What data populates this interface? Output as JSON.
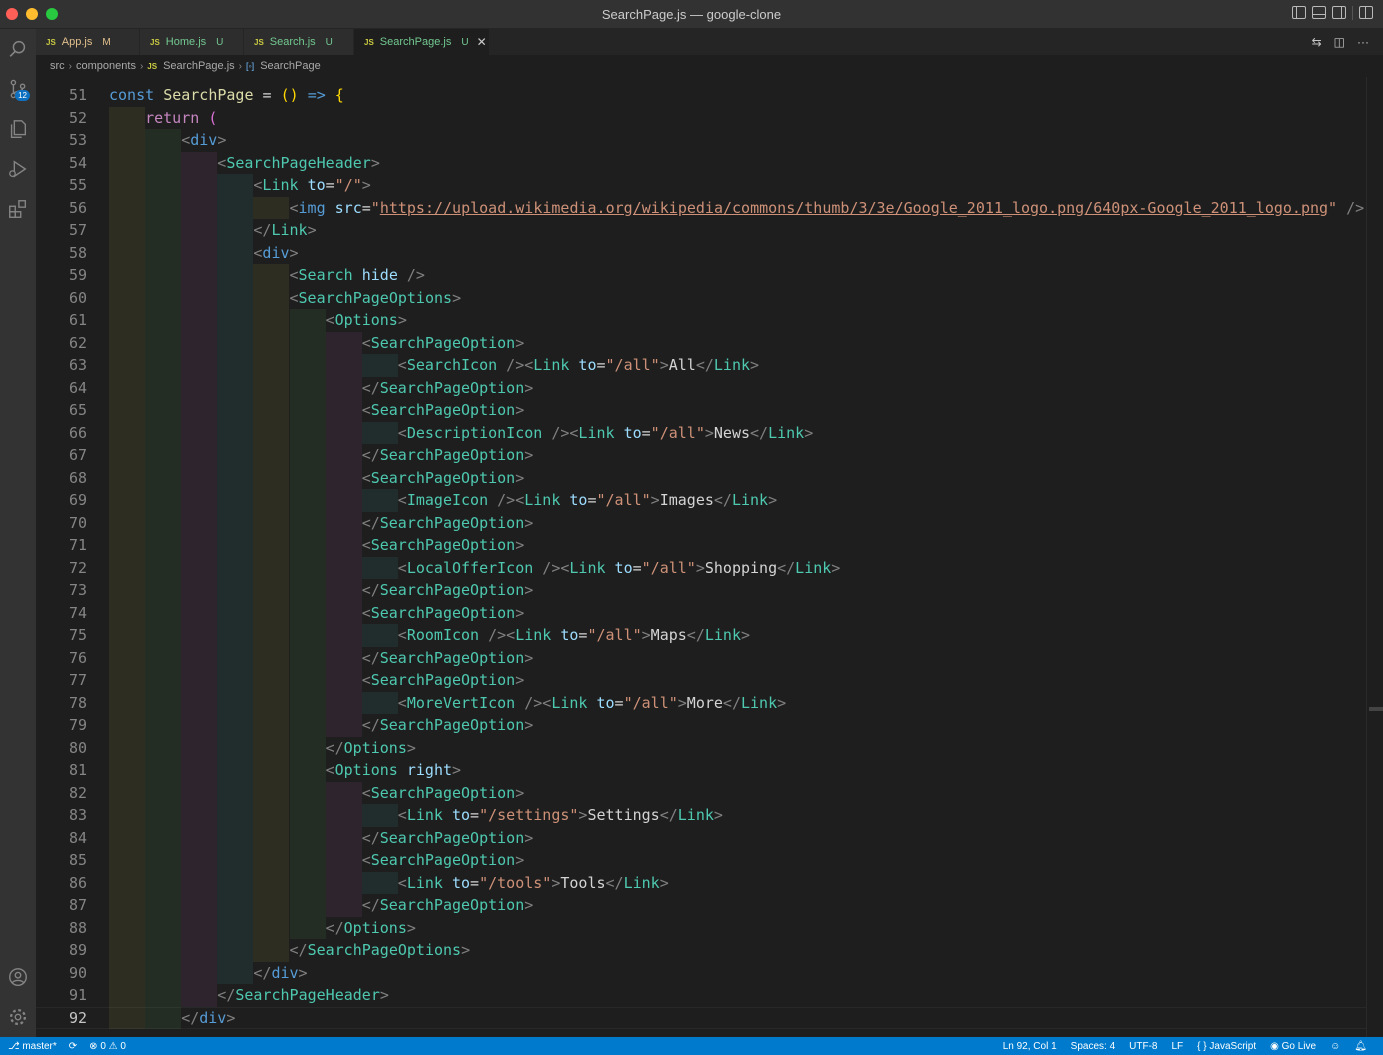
{
  "window": {
    "title": "SearchPage.js — google-clone"
  },
  "activity_bar": {
    "source_control_badge": "12"
  },
  "tabs": [
    {
      "label": "App.js",
      "status": "M",
      "active": false
    },
    {
      "label": "Home.js",
      "status": "U",
      "active": false
    },
    {
      "label": "Search.js",
      "status": "U",
      "active": false
    },
    {
      "label": "SearchPage.js",
      "status": "U",
      "active": true
    }
  ],
  "tab_file_icon": "JS",
  "tab_close_glyph": "✕",
  "breadcrumb": {
    "items": [
      "src",
      "components",
      "SearchPage.js",
      "SearchPage"
    ]
  },
  "editor": {
    "current_line": "92",
    "lines": [
      {
        "n": "51",
        "tokens": [
          [
            "kw",
            "const "
          ],
          [
            "fn",
            "SearchPage"
          ],
          [
            "op",
            " = "
          ],
          [
            "br",
            "()"
          ],
          [
            "op",
            " "
          ],
          [
            "kw",
            "=>"
          ],
          [
            "op",
            " "
          ],
          [
            "br",
            "{"
          ]
        ]
      },
      {
        "n": "52",
        "tokens": [
          [
            "kw2",
            "return "
          ],
          [
            "br2",
            "("
          ]
        ]
      },
      {
        "n": "53",
        "tokens": [
          [
            "pn",
            "<"
          ],
          [
            "tgh",
            "div"
          ],
          [
            "pn",
            ">"
          ]
        ]
      },
      {
        "n": "54",
        "tokens": [
          [
            "pn",
            "<"
          ],
          [
            "tg",
            "SearchPageHeader"
          ],
          [
            "pn",
            ">"
          ]
        ]
      },
      {
        "n": "55",
        "tokens": [
          [
            "pn",
            "<"
          ],
          [
            "tg",
            "Link"
          ],
          [
            "op",
            " "
          ],
          [
            "at",
            "to"
          ],
          [
            "op",
            "="
          ],
          [
            "st",
            "\"/\""
          ],
          [
            "pn",
            ">"
          ]
        ]
      },
      {
        "n": "56",
        "tokens": [
          [
            "pn",
            "<"
          ],
          [
            "tgh",
            "img"
          ],
          [
            "op",
            " "
          ],
          [
            "at",
            "src"
          ],
          [
            "op",
            "="
          ],
          [
            "st",
            "\""
          ],
          [
            "ln",
            "https://upload.wikimedia.org/wikipedia/commons/thumb/3/3e/Google_2011_logo.png/640px-Google_2011_logo.png"
          ],
          [
            "st",
            "\""
          ],
          [
            "op",
            " "
          ],
          [
            "pn",
            "/>"
          ]
        ]
      },
      {
        "n": "57",
        "tokens": [
          [
            "pn",
            "</"
          ],
          [
            "tg",
            "Link"
          ],
          [
            "pn",
            ">"
          ]
        ]
      },
      {
        "n": "58",
        "tokens": [
          [
            "pn",
            "<"
          ],
          [
            "tgh",
            "div"
          ],
          [
            "pn",
            ">"
          ]
        ]
      },
      {
        "n": "59",
        "tokens": [
          [
            "pn",
            "<"
          ],
          [
            "tg",
            "Search"
          ],
          [
            "op",
            " "
          ],
          [
            "at",
            "hide"
          ],
          [
            "op",
            " "
          ],
          [
            "pn",
            "/>"
          ]
        ]
      },
      {
        "n": "60",
        "tokens": [
          [
            "pn",
            "<"
          ],
          [
            "tg",
            "SearchPageOptions"
          ],
          [
            "pn",
            ">"
          ]
        ]
      },
      {
        "n": "61",
        "tokens": [
          [
            "pn",
            "<"
          ],
          [
            "tg",
            "Options"
          ],
          [
            "pn",
            ">"
          ]
        ]
      },
      {
        "n": "62",
        "tokens": [
          [
            "pn",
            "<"
          ],
          [
            "tg",
            "SearchPageOption"
          ],
          [
            "pn",
            ">"
          ]
        ]
      },
      {
        "n": "63",
        "tokens": [
          [
            "pn",
            "<"
          ],
          [
            "tg",
            "SearchIcon"
          ],
          [
            "op",
            " "
          ],
          [
            "pn",
            "/><"
          ],
          [
            "tg",
            "Link"
          ],
          [
            "op",
            " "
          ],
          [
            "at",
            "to"
          ],
          [
            "op",
            "="
          ],
          [
            "st",
            "\"/all\""
          ],
          [
            "pn",
            ">"
          ],
          [
            "tx",
            "All"
          ],
          [
            "pn",
            "</"
          ],
          [
            "tg",
            "Link"
          ],
          [
            "pn",
            ">"
          ]
        ]
      },
      {
        "n": "64",
        "tokens": [
          [
            "pn",
            "</"
          ],
          [
            "tg",
            "SearchPageOption"
          ],
          [
            "pn",
            ">"
          ]
        ]
      },
      {
        "n": "65",
        "tokens": [
          [
            "pn",
            "<"
          ],
          [
            "tg",
            "SearchPageOption"
          ],
          [
            "pn",
            ">"
          ]
        ]
      },
      {
        "n": "66",
        "tokens": [
          [
            "pn",
            "<"
          ],
          [
            "tg",
            "DescriptionIcon"
          ],
          [
            "op",
            " "
          ],
          [
            "pn",
            "/><"
          ],
          [
            "tg",
            "Link"
          ],
          [
            "op",
            " "
          ],
          [
            "at",
            "to"
          ],
          [
            "op",
            "="
          ],
          [
            "st",
            "\"/all\""
          ],
          [
            "pn",
            ">"
          ],
          [
            "tx",
            "News"
          ],
          [
            "pn",
            "</"
          ],
          [
            "tg",
            "Link"
          ],
          [
            "pn",
            ">"
          ]
        ]
      },
      {
        "n": "67",
        "tokens": [
          [
            "pn",
            "</"
          ],
          [
            "tg",
            "SearchPageOption"
          ],
          [
            "pn",
            ">"
          ]
        ]
      },
      {
        "n": "68",
        "tokens": [
          [
            "pn",
            "<"
          ],
          [
            "tg",
            "SearchPageOption"
          ],
          [
            "pn",
            ">"
          ]
        ]
      },
      {
        "n": "69",
        "tokens": [
          [
            "pn",
            "<"
          ],
          [
            "tg",
            "ImageIcon"
          ],
          [
            "op",
            " "
          ],
          [
            "pn",
            "/><"
          ],
          [
            "tg",
            "Link"
          ],
          [
            "op",
            " "
          ],
          [
            "at",
            "to"
          ],
          [
            "op",
            "="
          ],
          [
            "st",
            "\"/all\""
          ],
          [
            "pn",
            ">"
          ],
          [
            "tx",
            "Images"
          ],
          [
            "pn",
            "</"
          ],
          [
            "tg",
            "Link"
          ],
          [
            "pn",
            ">"
          ]
        ]
      },
      {
        "n": "70",
        "tokens": [
          [
            "pn",
            "</"
          ],
          [
            "tg",
            "SearchPageOption"
          ],
          [
            "pn",
            ">"
          ]
        ]
      },
      {
        "n": "71",
        "tokens": [
          [
            "pn",
            "<"
          ],
          [
            "tg",
            "SearchPageOption"
          ],
          [
            "pn",
            ">"
          ]
        ]
      },
      {
        "n": "72",
        "tokens": [
          [
            "pn",
            "<"
          ],
          [
            "tg",
            "LocalOfferIcon"
          ],
          [
            "op",
            " "
          ],
          [
            "pn",
            "/><"
          ],
          [
            "tg",
            "Link"
          ],
          [
            "op",
            " "
          ],
          [
            "at",
            "to"
          ],
          [
            "op",
            "="
          ],
          [
            "st",
            "\"/all\""
          ],
          [
            "pn",
            ">"
          ],
          [
            "tx",
            "Shopping"
          ],
          [
            "pn",
            "</"
          ],
          [
            "tg",
            "Link"
          ],
          [
            "pn",
            ">"
          ]
        ]
      },
      {
        "n": "73",
        "tokens": [
          [
            "pn",
            "</"
          ],
          [
            "tg",
            "SearchPageOption"
          ],
          [
            "pn",
            ">"
          ]
        ]
      },
      {
        "n": "74",
        "tokens": [
          [
            "pn",
            "<"
          ],
          [
            "tg",
            "SearchPageOption"
          ],
          [
            "pn",
            ">"
          ]
        ]
      },
      {
        "n": "75",
        "tokens": [
          [
            "pn",
            "<"
          ],
          [
            "tg",
            "RoomIcon"
          ],
          [
            "op",
            " "
          ],
          [
            "pn",
            "/><"
          ],
          [
            "tg",
            "Link"
          ],
          [
            "op",
            " "
          ],
          [
            "at",
            "to"
          ],
          [
            "op",
            "="
          ],
          [
            "st",
            "\"/all\""
          ],
          [
            "pn",
            ">"
          ],
          [
            "tx",
            "Maps"
          ],
          [
            "pn",
            "</"
          ],
          [
            "tg",
            "Link"
          ],
          [
            "pn",
            ">"
          ]
        ]
      },
      {
        "n": "76",
        "tokens": [
          [
            "pn",
            "</"
          ],
          [
            "tg",
            "SearchPageOption"
          ],
          [
            "pn",
            ">"
          ]
        ]
      },
      {
        "n": "77",
        "tokens": [
          [
            "pn",
            "<"
          ],
          [
            "tg",
            "SearchPageOption"
          ],
          [
            "pn",
            ">"
          ]
        ]
      },
      {
        "n": "78",
        "tokens": [
          [
            "pn",
            "<"
          ],
          [
            "tg",
            "MoreVertIcon"
          ],
          [
            "op",
            " "
          ],
          [
            "pn",
            "/><"
          ],
          [
            "tg",
            "Link"
          ],
          [
            "op",
            " "
          ],
          [
            "at",
            "to"
          ],
          [
            "op",
            "="
          ],
          [
            "st",
            "\"/all\""
          ],
          [
            "pn",
            ">"
          ],
          [
            "tx",
            "More"
          ],
          [
            "pn",
            "</"
          ],
          [
            "tg",
            "Link"
          ],
          [
            "pn",
            ">"
          ]
        ]
      },
      {
        "n": "79",
        "tokens": [
          [
            "pn",
            "</"
          ],
          [
            "tg",
            "SearchPageOption"
          ],
          [
            "pn",
            ">"
          ]
        ]
      },
      {
        "n": "80",
        "tokens": [
          [
            "pn",
            "</"
          ],
          [
            "tg",
            "Options"
          ],
          [
            "pn",
            ">"
          ]
        ]
      },
      {
        "n": "81",
        "tokens": [
          [
            "pn",
            "<"
          ],
          [
            "tg",
            "Options"
          ],
          [
            "op",
            " "
          ],
          [
            "at",
            "right"
          ],
          [
            "pn",
            ">"
          ]
        ]
      },
      {
        "n": "82",
        "tokens": [
          [
            "pn",
            "<"
          ],
          [
            "tg",
            "SearchPageOption"
          ],
          [
            "pn",
            ">"
          ]
        ]
      },
      {
        "n": "83",
        "tokens": [
          [
            "pn",
            "<"
          ],
          [
            "tg",
            "Link"
          ],
          [
            "op",
            " "
          ],
          [
            "at",
            "to"
          ],
          [
            "op",
            "="
          ],
          [
            "st",
            "\"/settings\""
          ],
          [
            "pn",
            ">"
          ],
          [
            "tx",
            "Settings"
          ],
          [
            "pn",
            "</"
          ],
          [
            "tg",
            "Link"
          ],
          [
            "pn",
            ">"
          ]
        ]
      },
      {
        "n": "84",
        "tokens": [
          [
            "pn",
            "</"
          ],
          [
            "tg",
            "SearchPageOption"
          ],
          [
            "pn",
            ">"
          ]
        ]
      },
      {
        "n": "85",
        "tokens": [
          [
            "pn",
            "<"
          ],
          [
            "tg",
            "SearchPageOption"
          ],
          [
            "pn",
            ">"
          ]
        ]
      },
      {
        "n": "86",
        "tokens": [
          [
            "pn",
            "<"
          ],
          [
            "tg",
            "Link"
          ],
          [
            "op",
            " "
          ],
          [
            "at",
            "to"
          ],
          [
            "op",
            "="
          ],
          [
            "st",
            "\"/tools\""
          ],
          [
            "pn",
            ">"
          ],
          [
            "tx",
            "Tools"
          ],
          [
            "pn",
            "</"
          ],
          [
            "tg",
            "Link"
          ],
          [
            "pn",
            ">"
          ]
        ]
      },
      {
        "n": "87",
        "tokens": [
          [
            "pn",
            "</"
          ],
          [
            "tg",
            "SearchPageOption"
          ],
          [
            "pn",
            ">"
          ]
        ]
      },
      {
        "n": "88",
        "tokens": [
          [
            "pn",
            "</"
          ],
          [
            "tg",
            "Options"
          ],
          [
            "pn",
            ">"
          ]
        ]
      },
      {
        "n": "89",
        "tokens": [
          [
            "pn",
            "</"
          ],
          [
            "tg",
            "SearchPageOptions"
          ],
          [
            "pn",
            ">"
          ]
        ]
      },
      {
        "n": "90",
        "tokens": [
          [
            "pn",
            "</"
          ],
          [
            "tgh",
            "div"
          ],
          [
            "pn",
            ">"
          ]
        ]
      },
      {
        "n": "91",
        "tokens": [
          [
            "pn",
            "</"
          ],
          [
            "tg",
            "SearchPageHeader"
          ],
          [
            "pn",
            ">"
          ]
        ]
      },
      {
        "n": "92",
        "tokens": [
          [
            "pn",
            "</"
          ],
          [
            "tgh",
            "div"
          ],
          [
            "pn",
            ">"
          ]
        ]
      }
    ]
  },
  "status_bar": {
    "branch": "master*",
    "errors": "0",
    "warnings": "0",
    "cursor_position": "Ln 92, Col 1",
    "indentation": "Spaces: 4",
    "encoding": "UTF-8",
    "line_ending": "LF",
    "language": "JavaScript",
    "live_server": "Go Live"
  },
  "colors": {
    "statusbar_bg": "#007acc",
    "activitybar_bg": "#333333",
    "editor_bg": "#1e1e1e"
  }
}
